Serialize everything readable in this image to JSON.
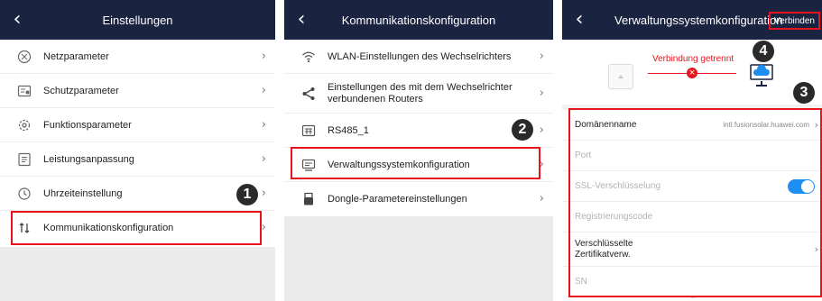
{
  "panel1": {
    "title": "Einstellungen",
    "items": [
      {
        "label": "Netzparameter",
        "icon": "grid-icon"
      },
      {
        "label": "Schutzparameter",
        "icon": "protection-icon"
      },
      {
        "label": "Funktionsparameter",
        "icon": "function-gear-icon"
      },
      {
        "label": "Leistungsanpassung",
        "icon": "power-list-icon"
      },
      {
        "label": "Uhrzeiteinstellung",
        "icon": "clock-icon"
      },
      {
        "label": "Kommunikationskonfiguration",
        "icon": "transfer-arrows-icon"
      }
    ],
    "step_badge": "1"
  },
  "panel2": {
    "title": "Kommunikationskonfiguration",
    "items": [
      {
        "label": "WLAN-Einstellungen des Wechselrichters",
        "icon": "wifi-icon"
      },
      {
        "label": "Einstellungen des mit dem Wechselrichter verbundenen Routers",
        "icon": "share-icon"
      },
      {
        "label": "RS485_1",
        "icon": "rs485-icon"
      },
      {
        "label": "Verwaltungssystemkonfiguration",
        "icon": "monitor-icon"
      },
      {
        "label": "Dongle-Parametereinstellungen",
        "icon": "dongle-icon"
      }
    ],
    "step_badge": "2"
  },
  "panel3": {
    "title": "Verwaltungssystemkonfiguration",
    "connect_label": "Verbinden",
    "status_text": "Verbindung getrennt",
    "fields": [
      {
        "label": "Domänenname",
        "value": "intl.fusionsolar.huawei.com"
      },
      {
        "label": "Port",
        "value": ""
      },
      {
        "label": "SSL-Verschlüsselung",
        "value": ""
      },
      {
        "label": "Registrierungscode",
        "value": ""
      },
      {
        "label": "Verschlüsselte Zertifikatverw.",
        "value": ""
      },
      {
        "label": "SN",
        "value": ""
      }
    ],
    "step_badge_3": "3",
    "step_badge_4": "4"
  },
  "colors": {
    "header": "#1a2340",
    "highlight": "#e8141b",
    "toggle_on": "#1e8ff0",
    "cloud": "#1e8ff0"
  }
}
